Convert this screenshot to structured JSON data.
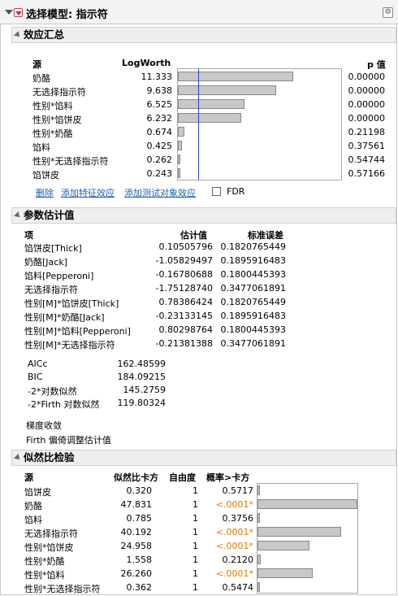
{
  "title": "选择模型: 指示符",
  "effect_summary": {
    "title": "效应汇总",
    "col_source": "源",
    "col_logworth": "LogWorth",
    "col_p": "p 值",
    "rows": [
      {
        "source": "奶酪",
        "logworth": "11.333",
        "p": "0.00000",
        "value": 11.333
      },
      {
        "source": "无选择指示符",
        "logworth": "9.638",
        "p": "0.00000",
        "value": 9.638
      },
      {
        "source": "性别*馅料",
        "logworth": "6.525",
        "p": "0.00000",
        "value": 6.525
      },
      {
        "source": "性别*馅饼皮",
        "logworth": "6.232",
        "p": "0.00000",
        "value": 6.232
      },
      {
        "source": "性别*奶酪",
        "logworth": "0.674",
        "p": "0.21198",
        "value": 0.674
      },
      {
        "source": "馅料",
        "logworth": "0.425",
        "p": "0.37561",
        "value": 0.425
      },
      {
        "source": "性别*无选择指示符",
        "logworth": "0.262",
        "p": "0.54744",
        "value": 0.262
      },
      {
        "source": "馅饼皮",
        "logworth": "0.243",
        "p": "0.57166",
        "value": 0.243
      }
    ],
    "ref_line_value": 2,
    "scale_max": 16,
    "remove_link": "删除",
    "add_feature_link": "添加特征效应",
    "add_subject_link": "添加测试对象效应",
    "fdr_label": "FDR"
  },
  "param_estimates": {
    "title": "参数估计值",
    "col_term": "项",
    "col_estimate": "估计值",
    "col_se": "标准误差",
    "rows": [
      {
        "term": "馅饼皮[Thick]",
        "estimate": "0.10505796",
        "se": "0.1820765449"
      },
      {
        "term": "奶酪[Jack]",
        "estimate": "-1.05829497",
        "se": "0.1895916483"
      },
      {
        "term": "馅料[Pepperoni]",
        "estimate": "-0.16780688",
        "se": "0.1800445393"
      },
      {
        "term": "无选择指示符",
        "estimate": "-1.75128740",
        "se": "0.3477061891"
      },
      {
        "term": "性别[M]*馅饼皮[Thick]",
        "estimate": "0.78386424",
        "se": "0.1820765449"
      },
      {
        "term": "性别[M]*奶酪[Jack]",
        "estimate": "-0.23133145",
        "se": "0.1895916483"
      },
      {
        "term": "性别[M]*馅料[Pepperoni]",
        "estimate": "0.80298764",
        "se": "0.1800445393"
      },
      {
        "term": "性别[M]*无选择指示符",
        "estimate": "-0.21381388",
        "se": "0.3477061891"
      }
    ],
    "stats": [
      {
        "label": "AICc",
        "value": "162.48599"
      },
      {
        "label": "BIC",
        "value": "184.09215"
      },
      {
        "label": "-2*对数似然",
        "value": "145.2759"
      },
      {
        "label": "-2*Firth 对数似然",
        "value": "119.80324"
      }
    ],
    "note1": "梯度收敛",
    "note2": "Firth 偏倚调整估计值"
  },
  "lr_tests": {
    "title": "似然比检验",
    "col_source": "源",
    "col_chisq": "似然比卡方",
    "col_df": "自由度",
    "col_prob": "概率>卡方",
    "rows": [
      {
        "source": "馅饼皮",
        "chisq": "0.320",
        "df": "1",
        "prob": "0.5717",
        "sig": false,
        "value": 0.32
      },
      {
        "source": "奶酪",
        "chisq": "47.831",
        "df": "1",
        "prob": "<.0001*",
        "sig": true,
        "value": 47.831
      },
      {
        "source": "馅料",
        "chisq": "0.785",
        "df": "1",
        "prob": "0.3756",
        "sig": false,
        "value": 0.785
      },
      {
        "source": "无选择指示符",
        "chisq": "40.192",
        "df": "1",
        "prob": "<.0001*",
        "sig": true,
        "value": 40.192
      },
      {
        "source": "性别*馅饼皮",
        "chisq": "24.958",
        "df": "1",
        "prob": "<.0001*",
        "sig": true,
        "value": 24.958
      },
      {
        "source": "性别*奶酪",
        "chisq": "1.558",
        "df": "1",
        "prob": "0.2120",
        "sig": false,
        "value": 1.558
      },
      {
        "source": "性别*馅料",
        "chisq": "26.260",
        "df": "1",
        "prob": "<.0001*",
        "sig": true,
        "value": 26.26
      },
      {
        "source": "性别*无选择指示符",
        "chisq": "0.362",
        "df": "1",
        "prob": "0.5474",
        "sig": false,
        "value": 0.362
      }
    ],
    "scale_max": 47.831
  }
}
